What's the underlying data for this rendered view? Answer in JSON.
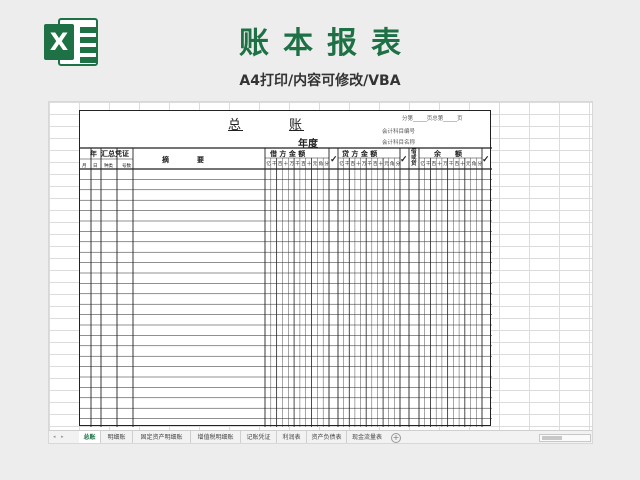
{
  "banner": {
    "logo_letter": "X",
    "logo_icon": "excel-logo-icon",
    "title": "账本报表",
    "subtitle": "A4打印/内容可修改/VBA"
  },
  "ledger": {
    "title_left": "总",
    "title_right": "账",
    "year_label": "年度",
    "page_info": "分第_____页总第_____页",
    "account_code_label": "会计科目编号",
    "account_name_label": "会计科目名称",
    "headers": {
      "year": "年",
      "summary_voucher": "汇总凭证",
      "month": "月",
      "day": "日",
      "kind": "种类",
      "number": "号数",
      "description": "摘　　　　要",
      "debit": "借 方 金 额",
      "credit": "贷 方 金 额",
      "check": "✓",
      "debit_or_credit": "借或贷",
      "balance": "余　　额"
    },
    "digit_units": [
      "亿",
      "千",
      "百",
      "十",
      "万",
      "千",
      "百",
      "十",
      "元",
      "角",
      "分"
    ]
  },
  "tabs": {
    "items": [
      {
        "label": "总账",
        "active": true
      },
      {
        "label": "明细账",
        "active": false
      },
      {
        "label": "固定资产明细账",
        "active": false
      },
      {
        "label": "增值税明细账",
        "active": false
      },
      {
        "label": "记账凭证",
        "active": false
      },
      {
        "label": "利润表",
        "active": false
      },
      {
        "label": "资产负债表",
        "active": false
      },
      {
        "label": "现金流量表",
        "active": false
      }
    ],
    "add_label": "+"
  },
  "colors": {
    "brand": "#1e7145",
    "grid": "#dcdcdc",
    "ledger_line": "#222222"
  }
}
